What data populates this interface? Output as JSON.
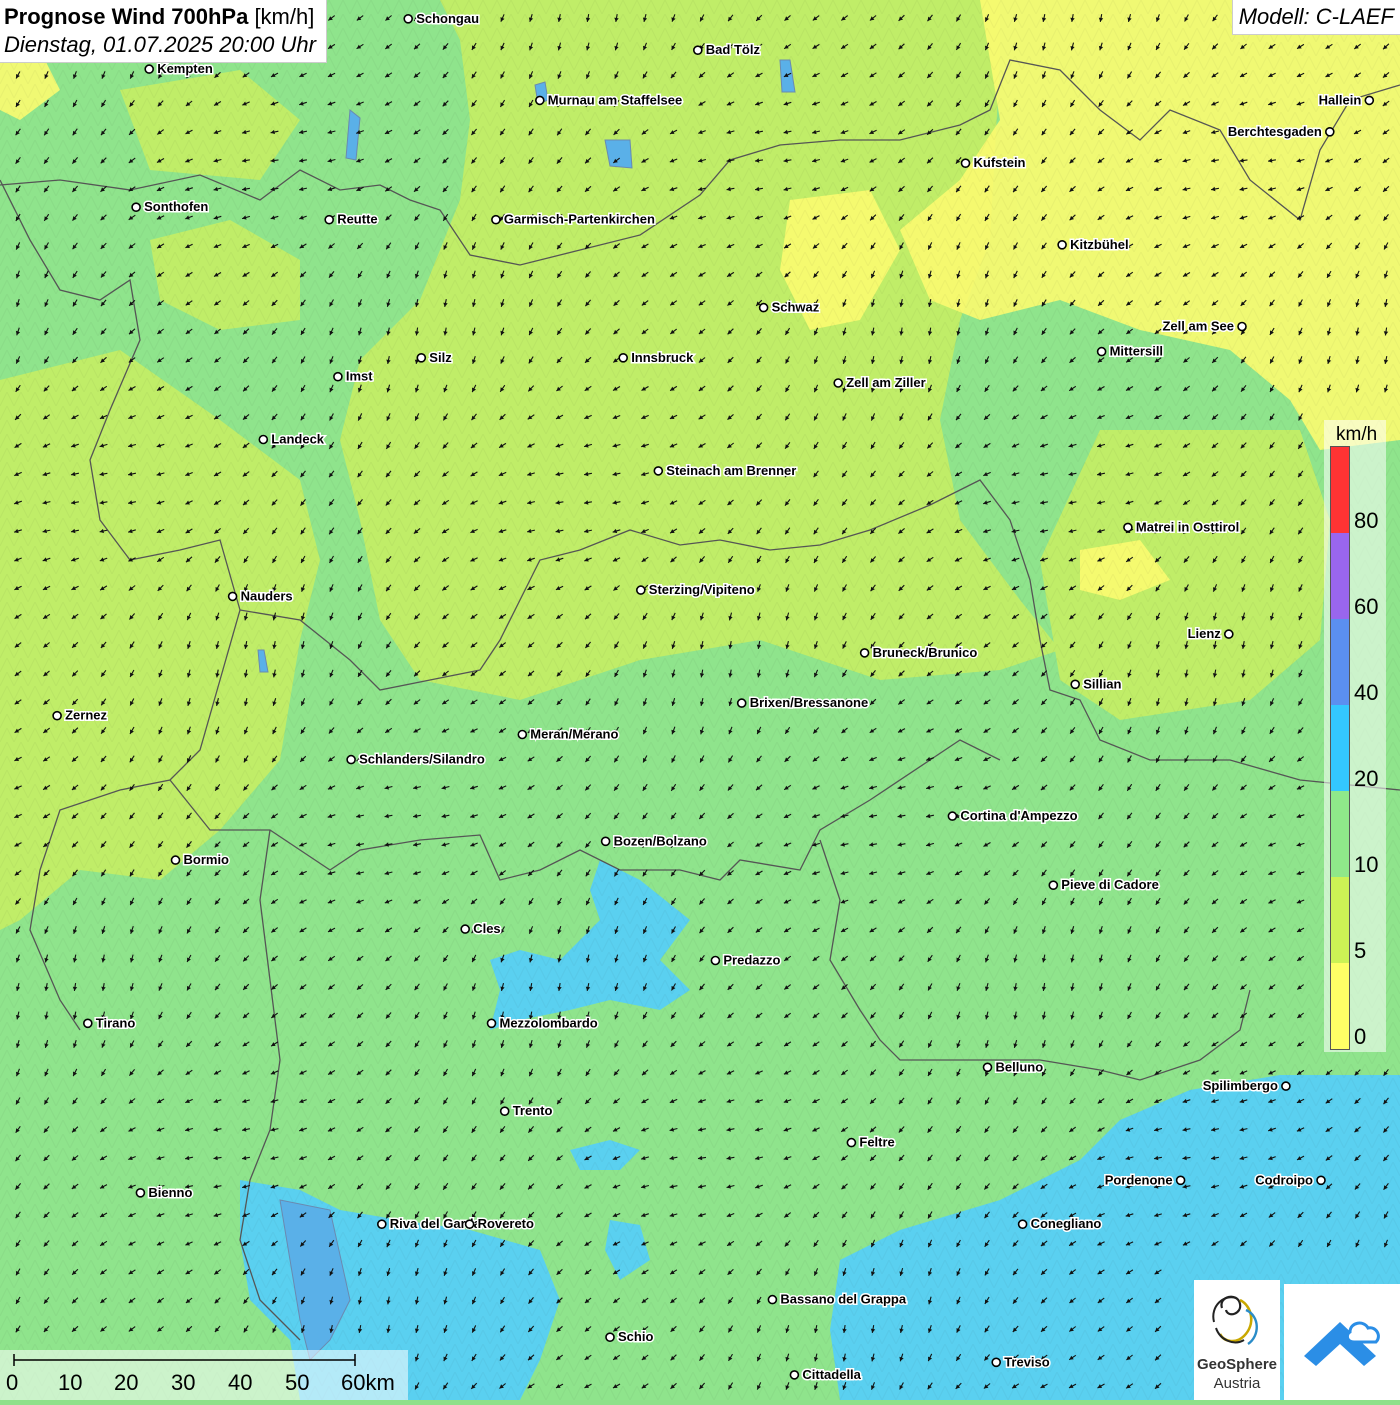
{
  "header": {
    "title_bold": "Prognose Wind 700hPa",
    "title_unit": "[km/h]",
    "datetime": "Dienstag, 01.07.2025 20:00 Uhr",
    "model": "Modell: C-LAEF"
  },
  "legend": {
    "unit": "km/h",
    "labels": [
      "80",
      "60",
      "40",
      "20",
      "10",
      "5",
      "0"
    ],
    "colors": [
      "#ff3333",
      "#9966ee",
      "#5b8ff0",
      "#33c7ff",
      "#8fe88a",
      "#ccf255",
      "#ffff66"
    ]
  },
  "scale": {
    "labels": [
      "0",
      "10",
      "20",
      "30",
      "40",
      "50",
      "60km"
    ]
  },
  "logo": {
    "name": "GeoSphere",
    "subtitle": "Austria"
  },
  "cities": [
    {
      "name": "Schongau",
      "lon": 10.9,
      "lat": 47.81
    },
    {
      "name": "Bad Tölz",
      "lon": 11.56,
      "lat": 47.76
    },
    {
      "name": "Kempten",
      "lon": 10.31,
      "lat": 47.73
    },
    {
      "name": "Murnau am Staffelsee",
      "lon": 11.2,
      "lat": 47.68
    },
    {
      "name": "Hallein",
      "lon": 13.09,
      "lat": 47.68
    },
    {
      "name": "Berchtesgaden",
      "lon": 13.0,
      "lat": 47.63
    },
    {
      "name": "Kufstein",
      "lon": 12.17,
      "lat": 47.58
    },
    {
      "name": "Sonthofen",
      "lon": 10.28,
      "lat": 47.51
    },
    {
      "name": "Reutte",
      "lon": 10.72,
      "lat": 47.49
    },
    {
      "name": "Garmisch-Partenkirchen",
      "lon": 11.1,
      "lat": 47.49
    },
    {
      "name": "Kitzbühel",
      "lon": 12.39,
      "lat": 47.45
    },
    {
      "name": "Schwaz",
      "lon": 11.71,
      "lat": 47.35
    },
    {
      "name": "Zell am See",
      "lon": 12.8,
      "lat": 47.32
    },
    {
      "name": "Mittersill",
      "lon": 12.48,
      "lat": 47.28
    },
    {
      "name": "Silz",
      "lon": 10.93,
      "lat": 47.27
    },
    {
      "name": "Innsbruck",
      "lon": 11.39,
      "lat": 47.27
    },
    {
      "name": "Imst",
      "lon": 10.74,
      "lat": 47.24
    },
    {
      "name": "Zell am Ziller",
      "lon": 11.88,
      "lat": 47.23
    },
    {
      "name": "Landeck",
      "lon": 10.57,
      "lat": 47.14
    },
    {
      "name": "Steinach am Brenner",
      "lon": 11.47,
      "lat": 47.09
    },
    {
      "name": "Matrei in Osttirol",
      "lon": 12.54,
      "lat": 47.0
    },
    {
      "name": "Nauders",
      "lon": 10.5,
      "lat": 46.89
    },
    {
      "name": "Sterzing/Vipiteno",
      "lon": 11.43,
      "lat": 46.9
    },
    {
      "name": "Lienz",
      "lon": 12.77,
      "lat": 46.83
    },
    {
      "name": "Bruneck/Brunico",
      "lon": 11.94,
      "lat": 46.8
    },
    {
      "name": "Sillian",
      "lon": 12.42,
      "lat": 46.75
    },
    {
      "name": "Brixen/Bressanone",
      "lon": 11.66,
      "lat": 46.72
    },
    {
      "name": "Zernez",
      "lon": 10.1,
      "lat": 46.7
    },
    {
      "name": "Meran/Merano",
      "lon": 11.16,
      "lat": 46.67
    },
    {
      "name": "Schlanders/Silandro",
      "lon": 10.77,
      "lat": 46.63
    },
    {
      "name": "Cortina d'Ampezzo",
      "lon": 12.14,
      "lat": 46.54
    },
    {
      "name": "Bozen/Bolzano",
      "lon": 11.35,
      "lat": 46.5
    },
    {
      "name": "Bormio",
      "lon": 10.37,
      "lat": 46.47
    },
    {
      "name": "Pieve di Cadore",
      "lon": 12.37,
      "lat": 46.43
    },
    {
      "name": "Cles",
      "lon": 11.03,
      "lat": 46.36
    },
    {
      "name": "Predazzo",
      "lon": 11.6,
      "lat": 46.31
    },
    {
      "name": "Tirano",
      "lon": 10.17,
      "lat": 46.21
    },
    {
      "name": "Mezzolombardo",
      "lon": 11.09,
      "lat": 46.21
    },
    {
      "name": "Belluno",
      "lon": 12.22,
      "lat": 46.14
    },
    {
      "name": "Spilimbergo",
      "lon": 12.9,
      "lat": 46.11
    },
    {
      "name": "Trento",
      "lon": 11.12,
      "lat": 46.07
    },
    {
      "name": "Feltre",
      "lon": 11.91,
      "lat": 46.02
    },
    {
      "name": "Pordenone",
      "lon": 12.66,
      "lat": 45.96
    },
    {
      "name": "Codroipo",
      "lon": 12.98,
      "lat": 45.96
    },
    {
      "name": "Bienno",
      "lon": 10.29,
      "lat": 45.94
    },
    {
      "name": "Riva del Garda",
      "lon": 10.84,
      "lat": 45.89
    },
    {
      "name": "Rovereto",
      "lon": 11.04,
      "lat": 45.89
    },
    {
      "name": "Conegliano",
      "lon": 12.3,
      "lat": 45.89
    },
    {
      "name": "Bassano del Grappa",
      "lon": 11.73,
      "lat": 45.77
    },
    {
      "name": "Schio",
      "lon": 11.36,
      "lat": 45.71
    },
    {
      "name": "Treviso",
      "lon": 12.24,
      "lat": 45.67
    },
    {
      "name": "Cittadella",
      "lon": 11.78,
      "lat": 45.65
    }
  ],
  "map_extent": {
    "lon_min": 9.97,
    "lon_max": 13.16,
    "lat_min": 45.61,
    "lat_max": 47.84
  },
  "wind": {
    "direction": "north-east",
    "typical_speed_kmh": 10
  }
}
